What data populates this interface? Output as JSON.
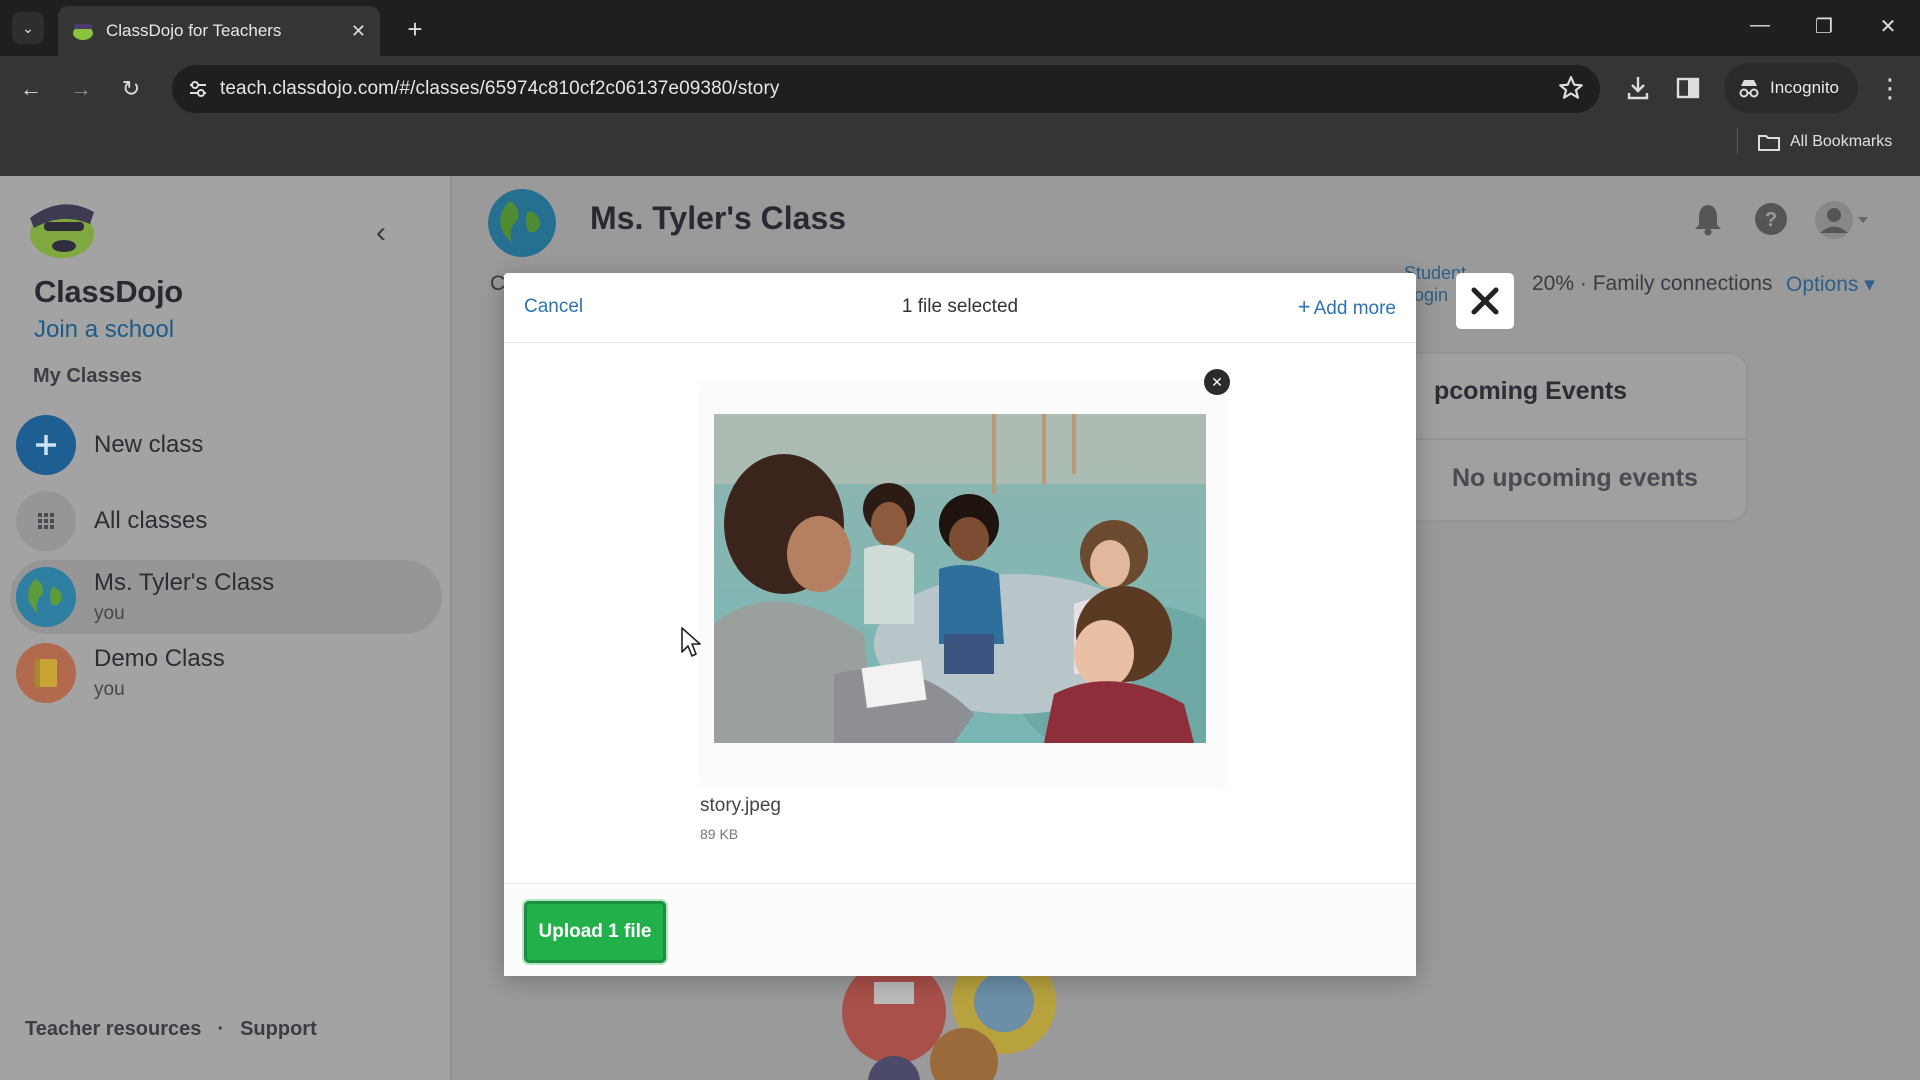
{
  "browser": {
    "tab_title": "ClassDojo for Teachers",
    "url": "teach.classdojo.com/#/classes/65974c810cf2c06137e09380/story",
    "incognito_label": "Incognito",
    "bookmarks_label": "All Bookmarks",
    "tab_close": "✕",
    "new_tab": "+",
    "tab_list": "⌄",
    "window_controls": {
      "minimize": "—",
      "restore": "❐",
      "close": "✕"
    },
    "nav": {
      "back": "←",
      "forward": "→",
      "reload": "↻"
    },
    "menu": "⋮"
  },
  "sidebar": {
    "brand": "ClassDojo",
    "join_school": "Join a school",
    "section_title": "My Classes",
    "collapse": "‹",
    "items": [
      {
        "label": "New class",
        "icon": "plus-icon"
      },
      {
        "label": "All classes",
        "icon": "grid-icon"
      },
      {
        "label": "Ms. Tyler's Class",
        "sublabel": "you",
        "icon": "globe-icon",
        "active": true
      },
      {
        "label": "Demo Class",
        "sublabel": "you",
        "icon": "notebook-icon"
      }
    ],
    "footer": {
      "resources": "Teacher resources",
      "separator": "·",
      "support": "Support"
    }
  },
  "main": {
    "class_title": "Ms. Tyler's Class",
    "tab_fragment": "C",
    "student_login": [
      "Student",
      "ogin"
    ],
    "family_connections": "20% · Family connections",
    "options": "Options ▾",
    "events": {
      "title": "pcoming Events",
      "empty": "No upcoming events"
    }
  },
  "modal": {
    "cancel": "Cancel",
    "title": "1 file selected",
    "add_more": "Add more",
    "add_more_icon": "+",
    "file": {
      "name": "story.jpeg",
      "size": "89 KB"
    },
    "remove_icon": "✕",
    "upload_button": "Upload 1 file",
    "close_icon": "✕"
  },
  "colors": {
    "brand_green": "#22b04a",
    "link_blue": "#2b73b8",
    "chrome_dark": "#1f1f1f"
  }
}
